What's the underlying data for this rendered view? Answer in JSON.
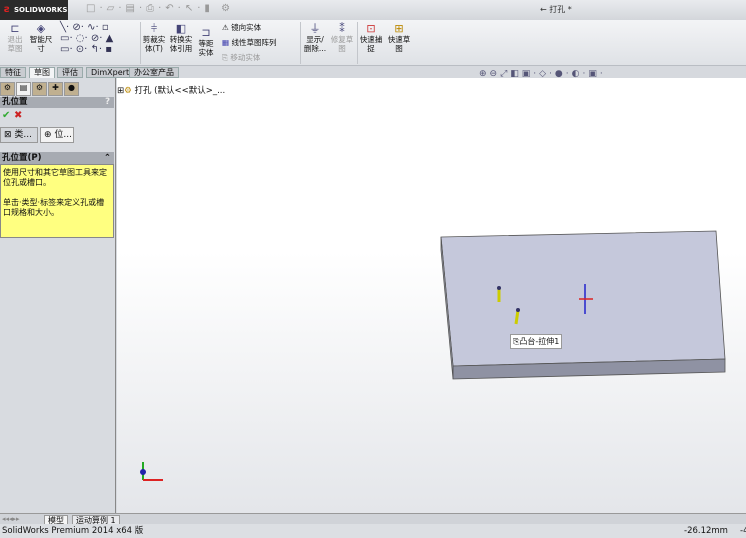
{
  "app": {
    "logo": "SOLIDWORKS",
    "document_title": "← 打孔 *"
  },
  "ribbon": {
    "exit_sketch": "退出草图",
    "smart_dim": "智能尺寸",
    "trim": "剪裁实体(T)",
    "convert": "转换实体引用",
    "offset": "等距实体",
    "mirror": "镜向实体",
    "linear_pattern": "线性草图阵列",
    "move": "移动实体",
    "show_delete": "显示/删除...",
    "repair": "修复草图",
    "quick_snap": "快速捕捉",
    "rapid_sketch": "快速草图"
  },
  "tabs": [
    {
      "label": "特征"
    },
    {
      "label": "草图",
      "active": true
    },
    {
      "label": "评估"
    },
    {
      "label": "DimXpert"
    },
    {
      "label": "办公室产品"
    }
  ],
  "panel": {
    "title": "孔位置",
    "help": "?",
    "tab_type": "类...",
    "tab_pos": "位...",
    "section": "孔位置(P)",
    "message1": "使用尺寸和其它草图工具来定位孔或槽口。",
    "message2": "单击·类型·标签来定义孔或槽口规格和大小。"
  },
  "tree": {
    "label": "打孔 (默认<<默认>_..."
  },
  "viewport": {
    "tooltip": "凸台-拉伸1"
  },
  "bottom_tabs": [
    {
      "label": "模型"
    },
    {
      "label": "运动算例 1"
    }
  ],
  "status": {
    "product": "SolidWorks Premium 2014 x64 版",
    "coord": "-26.12mm",
    "coord2": "-4"
  }
}
